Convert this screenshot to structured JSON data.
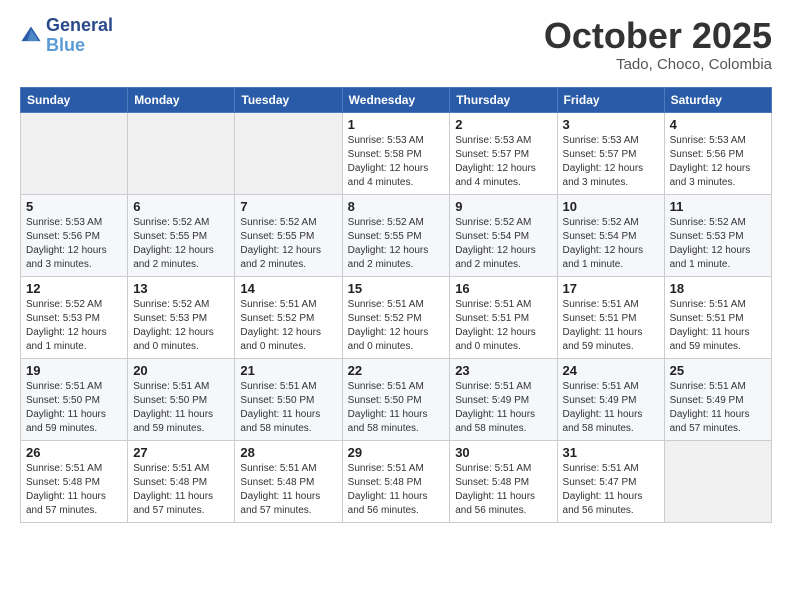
{
  "header": {
    "logo_line1": "General",
    "logo_line2": "Blue",
    "month": "October 2025",
    "location": "Tado, Choco, Colombia"
  },
  "weekdays": [
    "Sunday",
    "Monday",
    "Tuesday",
    "Wednesday",
    "Thursday",
    "Friday",
    "Saturday"
  ],
  "weeks": [
    [
      {
        "day": "",
        "info": ""
      },
      {
        "day": "",
        "info": ""
      },
      {
        "day": "",
        "info": ""
      },
      {
        "day": "1",
        "info": "Sunrise: 5:53 AM\nSunset: 5:58 PM\nDaylight: 12 hours\nand 4 minutes."
      },
      {
        "day": "2",
        "info": "Sunrise: 5:53 AM\nSunset: 5:57 PM\nDaylight: 12 hours\nand 4 minutes."
      },
      {
        "day": "3",
        "info": "Sunrise: 5:53 AM\nSunset: 5:57 PM\nDaylight: 12 hours\nand 3 minutes."
      },
      {
        "day": "4",
        "info": "Sunrise: 5:53 AM\nSunset: 5:56 PM\nDaylight: 12 hours\nand 3 minutes."
      }
    ],
    [
      {
        "day": "5",
        "info": "Sunrise: 5:53 AM\nSunset: 5:56 PM\nDaylight: 12 hours\nand 3 minutes."
      },
      {
        "day": "6",
        "info": "Sunrise: 5:52 AM\nSunset: 5:55 PM\nDaylight: 12 hours\nand 2 minutes."
      },
      {
        "day": "7",
        "info": "Sunrise: 5:52 AM\nSunset: 5:55 PM\nDaylight: 12 hours\nand 2 minutes."
      },
      {
        "day": "8",
        "info": "Sunrise: 5:52 AM\nSunset: 5:55 PM\nDaylight: 12 hours\nand 2 minutes."
      },
      {
        "day": "9",
        "info": "Sunrise: 5:52 AM\nSunset: 5:54 PM\nDaylight: 12 hours\nand 2 minutes."
      },
      {
        "day": "10",
        "info": "Sunrise: 5:52 AM\nSunset: 5:54 PM\nDaylight: 12 hours\nand 1 minute."
      },
      {
        "day": "11",
        "info": "Sunrise: 5:52 AM\nSunset: 5:53 PM\nDaylight: 12 hours\nand 1 minute."
      }
    ],
    [
      {
        "day": "12",
        "info": "Sunrise: 5:52 AM\nSunset: 5:53 PM\nDaylight: 12 hours\nand 1 minute."
      },
      {
        "day": "13",
        "info": "Sunrise: 5:52 AM\nSunset: 5:53 PM\nDaylight: 12 hours\nand 0 minutes."
      },
      {
        "day": "14",
        "info": "Sunrise: 5:51 AM\nSunset: 5:52 PM\nDaylight: 12 hours\nand 0 minutes."
      },
      {
        "day": "15",
        "info": "Sunrise: 5:51 AM\nSunset: 5:52 PM\nDaylight: 12 hours\nand 0 minutes."
      },
      {
        "day": "16",
        "info": "Sunrise: 5:51 AM\nSunset: 5:51 PM\nDaylight: 12 hours\nand 0 minutes."
      },
      {
        "day": "17",
        "info": "Sunrise: 5:51 AM\nSunset: 5:51 PM\nDaylight: 11 hours\nand 59 minutes."
      },
      {
        "day": "18",
        "info": "Sunrise: 5:51 AM\nSunset: 5:51 PM\nDaylight: 11 hours\nand 59 minutes."
      }
    ],
    [
      {
        "day": "19",
        "info": "Sunrise: 5:51 AM\nSunset: 5:50 PM\nDaylight: 11 hours\nand 59 minutes."
      },
      {
        "day": "20",
        "info": "Sunrise: 5:51 AM\nSunset: 5:50 PM\nDaylight: 11 hours\nand 59 minutes."
      },
      {
        "day": "21",
        "info": "Sunrise: 5:51 AM\nSunset: 5:50 PM\nDaylight: 11 hours\nand 58 minutes."
      },
      {
        "day": "22",
        "info": "Sunrise: 5:51 AM\nSunset: 5:50 PM\nDaylight: 11 hours\nand 58 minutes."
      },
      {
        "day": "23",
        "info": "Sunrise: 5:51 AM\nSunset: 5:49 PM\nDaylight: 11 hours\nand 58 minutes."
      },
      {
        "day": "24",
        "info": "Sunrise: 5:51 AM\nSunset: 5:49 PM\nDaylight: 11 hours\nand 58 minutes."
      },
      {
        "day": "25",
        "info": "Sunrise: 5:51 AM\nSunset: 5:49 PM\nDaylight: 11 hours\nand 57 minutes."
      }
    ],
    [
      {
        "day": "26",
        "info": "Sunrise: 5:51 AM\nSunset: 5:48 PM\nDaylight: 11 hours\nand 57 minutes."
      },
      {
        "day": "27",
        "info": "Sunrise: 5:51 AM\nSunset: 5:48 PM\nDaylight: 11 hours\nand 57 minutes."
      },
      {
        "day": "28",
        "info": "Sunrise: 5:51 AM\nSunset: 5:48 PM\nDaylight: 11 hours\nand 57 minutes."
      },
      {
        "day": "29",
        "info": "Sunrise: 5:51 AM\nSunset: 5:48 PM\nDaylight: 11 hours\nand 56 minutes."
      },
      {
        "day": "30",
        "info": "Sunrise: 5:51 AM\nSunset: 5:48 PM\nDaylight: 11 hours\nand 56 minutes."
      },
      {
        "day": "31",
        "info": "Sunrise: 5:51 AM\nSunset: 5:47 PM\nDaylight: 11 hours\nand 56 minutes."
      },
      {
        "day": "",
        "info": ""
      }
    ]
  ]
}
